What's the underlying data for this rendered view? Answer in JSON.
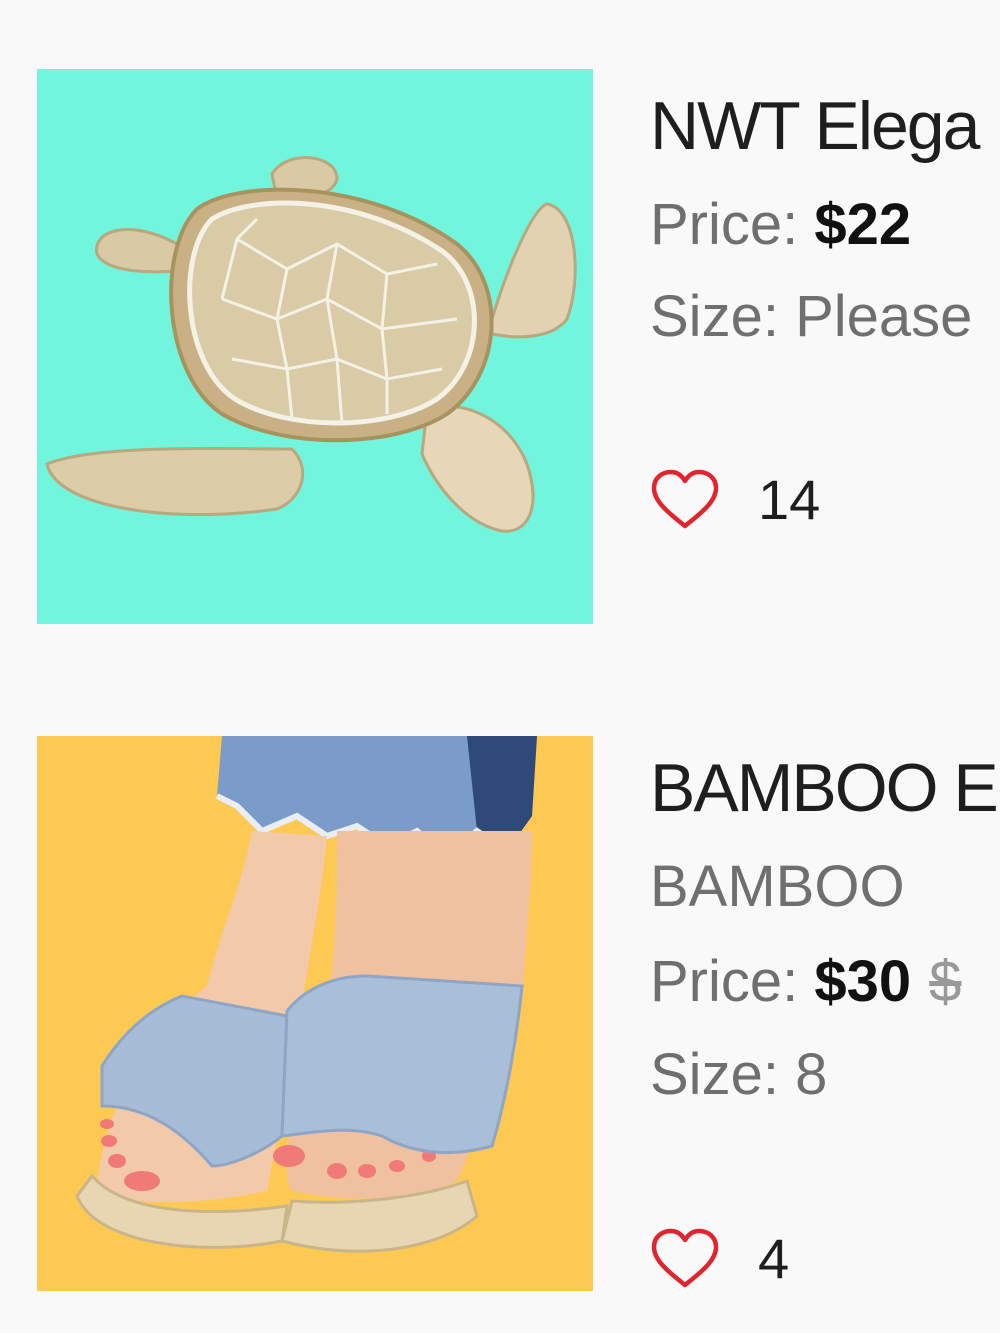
{
  "listings": [
    {
      "title": "NWT Elega",
      "price_label": "Price:",
      "price": "$22",
      "size_label": "Size:",
      "size": "Please",
      "likes": "14",
      "image_icon": "sea-turtle-figurine",
      "image_bg": "#72f5dd"
    },
    {
      "title": "BAMBOO E",
      "brand": "BAMBOO",
      "price_label": "Price:",
      "price": "$30",
      "original_price": "$",
      "size_label": "Size:",
      "size": "8",
      "likes": "4",
      "image_icon": "slide-sandals-photo",
      "image_bg": "#fdc953"
    }
  ],
  "colors": {
    "heart": "#e0252f",
    "background": "#f9f9f9"
  }
}
